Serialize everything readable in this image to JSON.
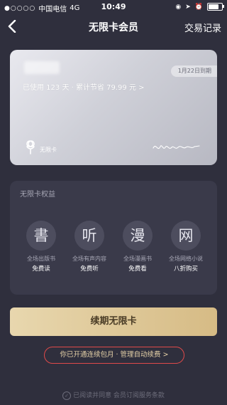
{
  "status_bar": {
    "signal_dots": "●○○○○",
    "carrier": "中国电信",
    "network": "4G",
    "time": "10:49",
    "battery_level": 0.85
  },
  "nav": {
    "title": "无限卡会员",
    "right_label": "交易记录"
  },
  "card": {
    "expiry": "1月22日到期",
    "stats": "已使用 123 天 · 累计节省 79.99 元 >",
    "logo_text": "无限卡",
    "signature": "Warmth"
  },
  "benefits": {
    "title": "无限卡权益",
    "items": [
      {
        "icon_char": "書",
        "line1": "全场出版书",
        "line2": "免费读"
      },
      {
        "icon_char": "听",
        "line1": "全场有声内容",
        "line2": "免费听"
      },
      {
        "icon_char": "漫",
        "line1": "全场漫画书",
        "line2": "免费看"
      },
      {
        "icon_char": "网",
        "line1": "全场网络小说",
        "line2": "八折购买"
      }
    ]
  },
  "renew_button": "续期无限卡",
  "auto_renew_link": "你已开通连续包月 · 管理自动续费 >",
  "agreement": "已阅读并同意 会员订阅服务条款",
  "colors": {
    "background": "#2f2f3d",
    "gold": "#d6bb85",
    "highlight_border": "#e04a4a"
  }
}
